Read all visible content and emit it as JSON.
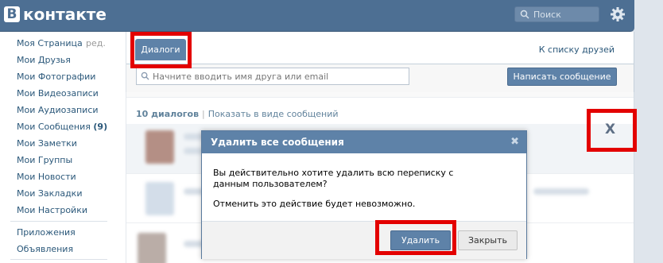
{
  "header": {
    "logo_letter": "В",
    "logo_text": "контакте",
    "search_placeholder": "Поиск",
    "color": "#4d6f93"
  },
  "sidebar": {
    "items": [
      {
        "label": "Моя Страница",
        "extra": "ред."
      },
      {
        "label": "Мои Друзья"
      },
      {
        "label": "Мои Фотографии"
      },
      {
        "label": "Мои Видеозаписи"
      },
      {
        "label": "Мои Аудиозаписи"
      },
      {
        "label": "Мои Сообщения",
        "count": "(9)"
      },
      {
        "label": "Мои Заметки"
      },
      {
        "label": "Мои Группы"
      },
      {
        "label": "Мои Новости"
      },
      {
        "label": "Мои Закладки"
      },
      {
        "label": "Мои Настройки"
      }
    ],
    "apps": [
      {
        "label": "Приложения"
      },
      {
        "label": "Объявления"
      }
    ]
  },
  "main": {
    "tab_label": "Диалоги",
    "friends_link": "К списку друзей",
    "friend_search_placeholder": "Начните вводить имя друга или email",
    "write_button": "Написать сообщение",
    "dialog_count": "10 диалогов",
    "separator": "|",
    "show_as_messages": "Показать в виде сообщений",
    "close_symbol": "X"
  },
  "modal": {
    "title": "Удалить все сообщения",
    "close_symbol": "✖",
    "text1": "Вы действительно хотите удалить всю переписку с данным пользователем?",
    "text2": "Отменить это действие будет невозможно.",
    "delete_button": "Удалить",
    "close_button": "Закрыть"
  },
  "colors": {
    "accent": "#5e82a8",
    "highlight": "#e30000",
    "link": "#2b587a"
  }
}
